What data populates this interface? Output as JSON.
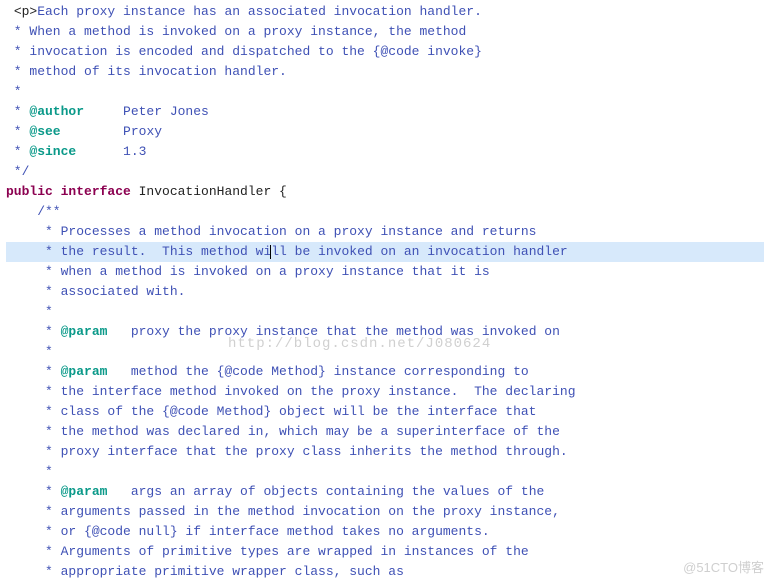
{
  "watermark_center": "http://blog.csdn.net/J080624",
  "watermark_corner": "@51CTO博客",
  "code": {
    "l01a": " ",
    "l01b": "<p>",
    "l01c": "Each proxy instance has an associated invocation handler.",
    "l02": " * When a method is invoked on a proxy instance, the method",
    "l03": " * invocation is encoded and dispatched to the {@code invoke}",
    "l04": " * method of its invocation handler.",
    "l05": " *",
    "l06a": " * ",
    "l06b": "@author",
    "l06c": "     Peter Jones",
    "l07a": " * ",
    "l07b": "@see",
    "l07c": "        Proxy",
    "l08a": " * ",
    "l08b": "@since",
    "l08c": "      1.3",
    "l09": " */",
    "l10a": "public interface ",
    "l10b": "InvocationHandler {",
    "l11": "",
    "l12": "    /**",
    "l13": "     * Processes a method invocation on a proxy instance and returns",
    "l14a": "     * the result.  This method wi",
    "l14b": "ll be invoked on an invocation handler",
    "l15": "     * when a method is invoked on a proxy instance that it is",
    "l16": "     * associated with.",
    "l17": "     *",
    "l18a": "     * ",
    "l18b": "@param",
    "l18c": "   proxy the proxy instance that the method was invoked on",
    "l19": "     *",
    "l20a": "     * ",
    "l20b": "@param",
    "l20c": "   method the {@code Method} instance corresponding to",
    "l21": "     * the interface method invoked on the proxy instance.  The declaring",
    "l22": "     * class of the {@code Method} object will be the interface that",
    "l23": "     * the method was declared in, which may be a superinterface of the",
    "l24": "     * proxy interface that the proxy class inherits the method through.",
    "l25": "     *",
    "l26a": "     * ",
    "l26b": "@param",
    "l26c": "   args an array of objects containing the values of the",
    "l27": "     * arguments passed in the method invocation on the proxy instance,",
    "l28": "     * or {@code null} if interface method takes no arguments.",
    "l29": "     * Arguments of primitive types are wrapped in instances of the",
    "l30": "     * appropriate primitive wrapper class, such as"
  }
}
